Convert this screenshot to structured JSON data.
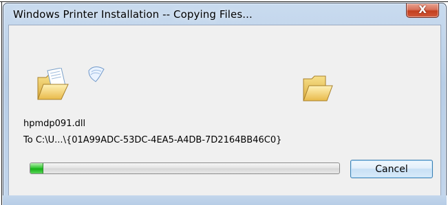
{
  "window": {
    "title": "Windows Printer Installation -- Copying Files...",
    "close_glyph": "X"
  },
  "animation": {
    "source_icon": "open-folder-icon",
    "paper_icon": "flying-document-icon",
    "target_icon": "open-folder-icon"
  },
  "copy": {
    "file_name": "hpmdp091.dll",
    "destination": "To C:\\U...\\{01A99ADC-53DC-4EA5-A4DB-7D2164BB46C0}"
  },
  "progress": {
    "fraction": 0.04
  },
  "buttons": {
    "cancel_label": "Cancel"
  },
  "colors": {
    "title_bar": "#b7cde6",
    "client_bg": "#f0f0f0",
    "progress_fill": "#16b016",
    "close_button": "#c3401f"
  }
}
